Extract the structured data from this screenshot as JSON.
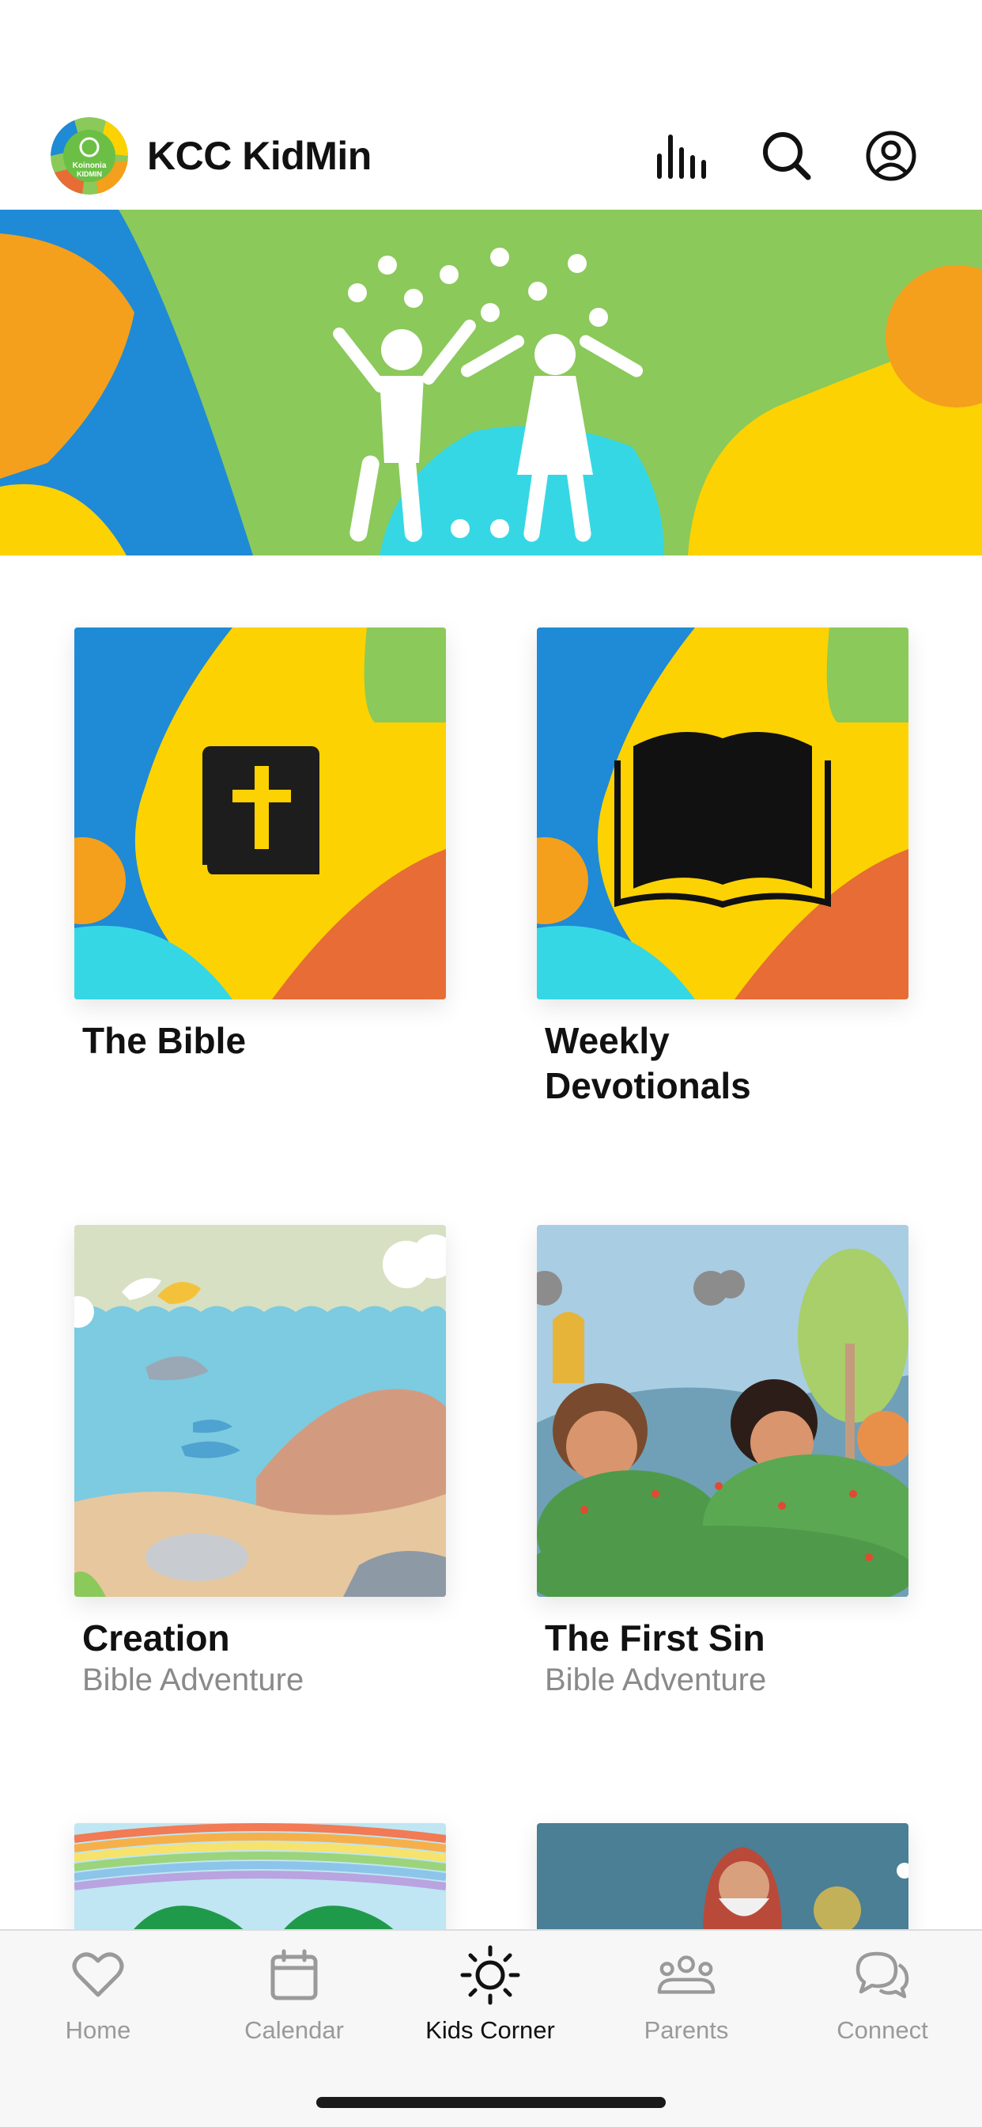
{
  "header": {
    "app_title": "KCC KidMin",
    "logo_line1": "Koinonia",
    "logo_line2": "KIDMIN",
    "icons": [
      "stats-bars-icon",
      "search-icon",
      "account-icon"
    ]
  },
  "cards": [
    {
      "title": "The Bible",
      "subtitle": "",
      "image": "bible-book-icon"
    },
    {
      "title": "Weekly Devotionals",
      "subtitle": "",
      "image": "open-book-icon"
    },
    {
      "title": "Creation",
      "subtitle": "Bible Adventure",
      "image": "ocean-creation-illustration"
    },
    {
      "title": "The First Sin",
      "subtitle": "Bible Adventure",
      "image": "garden-illustration"
    }
  ],
  "tabs": [
    {
      "label": "Home",
      "icon": "heart-icon",
      "active": false
    },
    {
      "label": "Calendar",
      "icon": "calendar-icon",
      "active": false
    },
    {
      "label": "Kids Corner",
      "icon": "sun-icon",
      "active": true
    },
    {
      "label": "Parents",
      "icon": "people-icon",
      "active": false
    },
    {
      "label": "Connect",
      "icon": "chat-bubbles-icon",
      "active": false
    }
  ],
  "colors": {
    "green": "#8bc95a",
    "blue": "#1f8ad6",
    "yellow": "#fcd202",
    "orange": "#f4a01c",
    "cyan": "#36d7e4",
    "red_orange": "#e86c35"
  }
}
